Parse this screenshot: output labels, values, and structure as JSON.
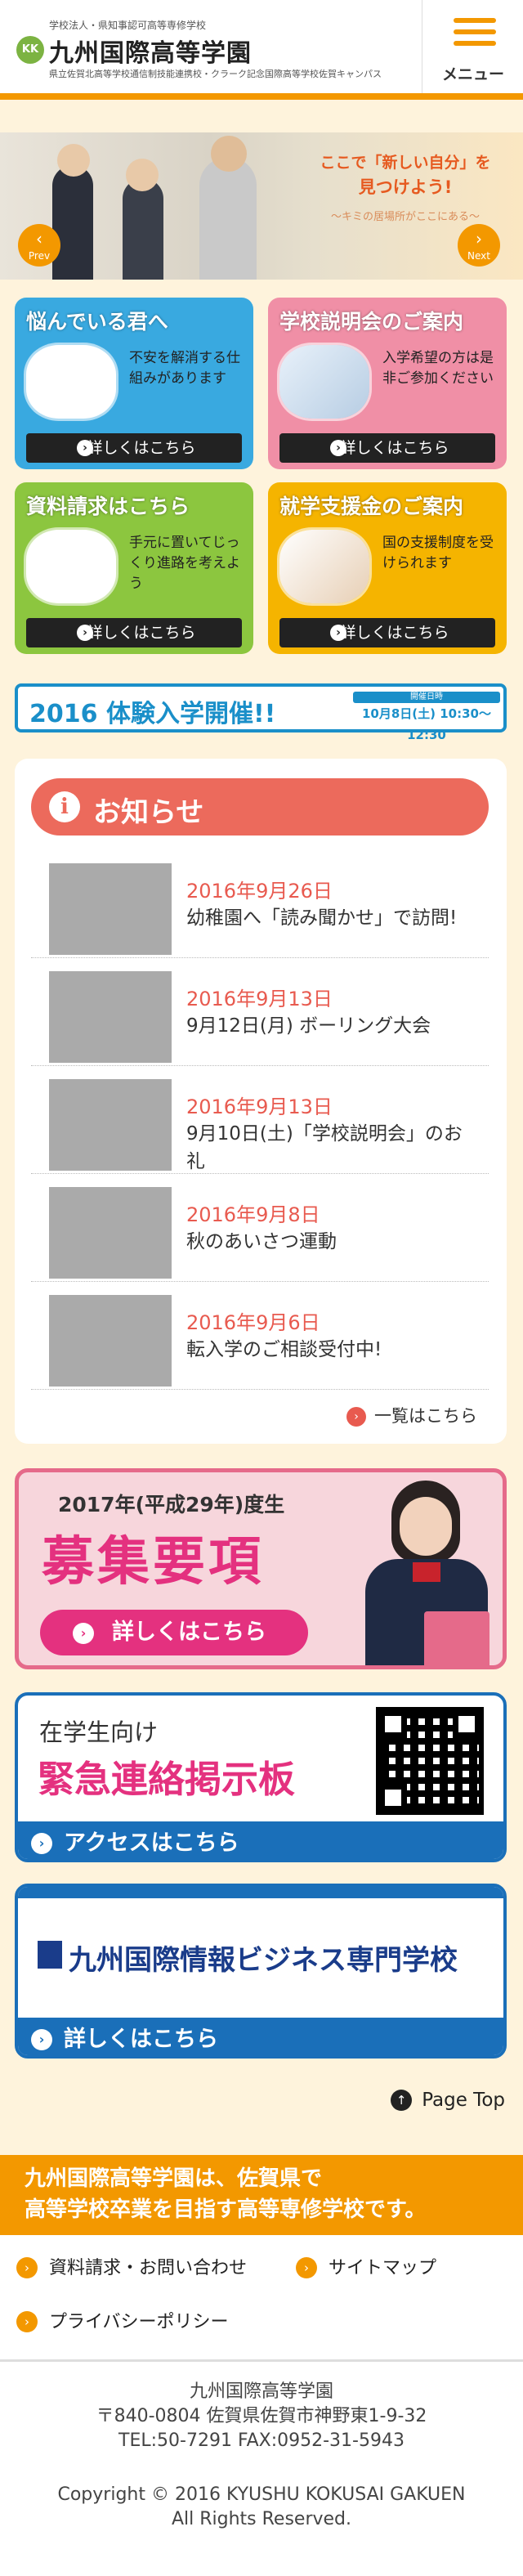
{
  "header": {
    "logo_small": "学校法人・県知事認可高等専修学校",
    "logo_mark": "KK",
    "logo_title": "九州国際高等学園",
    "logo_sub": "県立佐賀北高等学校通信制技能連携校・クラーク記念国際高等学校佐賀キャンパス",
    "menu_label": "メニュー"
  },
  "hero": {
    "line1": "ここで「新しい自分」を",
    "line2": "見つけよう!",
    "line3": "〜キミの居場所がここにある〜",
    "prev_label": "Prev",
    "next_label": "Next"
  },
  "tiles": [
    {
      "title": "悩んでいる君へ",
      "desc": "不安を解消する仕組みがあります",
      "btn": "詳しくはこちら",
      "color": "#39a9e0"
    },
    {
      "title": "学校説明会のご案内",
      "desc": "入学希望の方は是非ご参加ください",
      "btn": "詳しくはこちら",
      "color": "#f08fa6"
    },
    {
      "title": "資料請求はこちら",
      "desc": "手元に置いてじっくり進路を考えよう",
      "btn": "詳しくはこちら",
      "color": "#8cc63f"
    },
    {
      "title": "就学支援金のご案内",
      "desc": "国の支援制度を受けられます",
      "btn": "詳しくはこちら",
      "color": "#f5b400"
    }
  ],
  "event": {
    "title": "2016 体験入学開催!!",
    "date_label": "開催日時",
    "date": "10月8日(土) 10:30〜12:30"
  },
  "news": {
    "heading": "お知らせ",
    "items": [
      {
        "date": "2016年9月26日",
        "text": "幼稚園へ「読み聞かせ」で訪問!"
      },
      {
        "date": "2016年9月13日",
        "text": "9月12日(月)  ボーリング大会"
      },
      {
        "date": "2016年9月13日",
        "text": "9月10日(土)「学校説明会」のお礼"
      },
      {
        "date": "2016年9月8日",
        "text": "秋のあいさつ運動"
      },
      {
        "date": "2016年9月6日",
        "text": "転入学のご相談受付中!"
      }
    ],
    "more": "一覧はこちら"
  },
  "boshu": {
    "year": "2017年(平成29年)度生",
    "title": "募集要項",
    "btn": "詳しくはこちら"
  },
  "emergency": {
    "line1": "在学生向け",
    "line2": "緊急連絡掲示板",
    "btn": "アクセスはこちら"
  },
  "business": {
    "name": "九州国際情報ビジネス専門学校",
    "btn": "詳しくはこちら"
  },
  "pagetop": "Page Top",
  "banner": {
    "line1": "九州国際高等学園は、佐賀県で",
    "line2": "高等学校卒業を目指す高等専修学校です。"
  },
  "footer_links": [
    "資料請求・お問い合わせ",
    "サイトマップ",
    "プライバシーポリシー"
  ],
  "footer": {
    "name": "九州国際高等学園",
    "address": "〒840-0804 佐賀県佐賀市神野東1-9-32",
    "tel": "TEL:50-7291   FAX:0952-31-5943",
    "copyright": "Copyright © 2016 KYUSHU KOKUSAI GAKUEN",
    "rights": "All Rights Reserved."
  },
  "colors": {
    "accent": "#f39800",
    "news": "#ec6a5c",
    "blue": "#1a6fb9",
    "pink": "#e4317f"
  }
}
